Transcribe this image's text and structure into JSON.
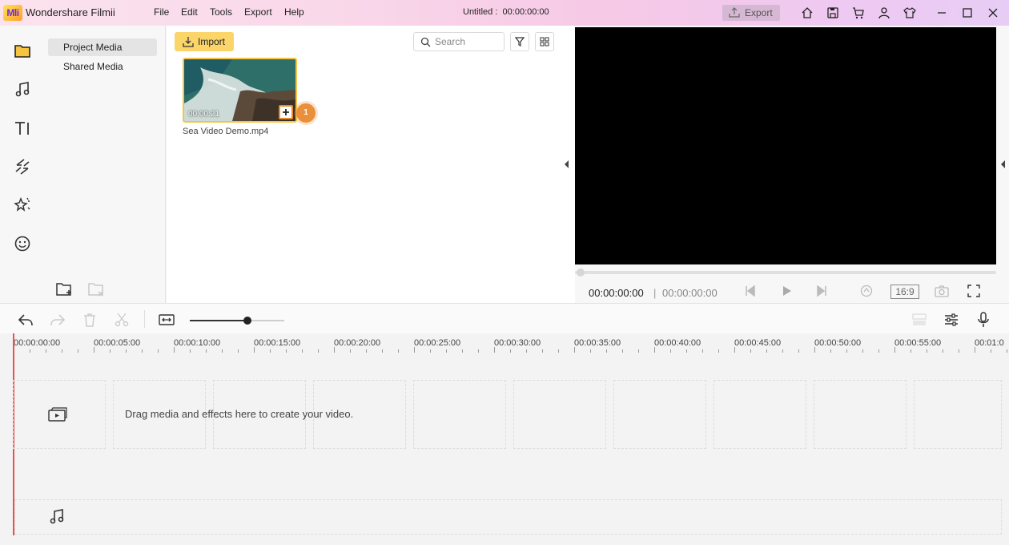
{
  "app": {
    "logo_text": "Mli",
    "name": "Wondershare Filmii"
  },
  "menu": [
    "File",
    "Edit",
    "Tools",
    "Export",
    "Help"
  ],
  "document": {
    "title": "Untitled :",
    "timecode": "00:00:00:00"
  },
  "titlebar": {
    "export_label": "Export",
    "icons": [
      "upload-icon",
      "home-icon",
      "save-icon",
      "cart-icon",
      "user-icon",
      "shirt-icon",
      "minimize-icon",
      "maximize-icon",
      "close-icon"
    ]
  },
  "rail": {
    "icons": [
      "folder-icon",
      "music-icon",
      "text-icon",
      "transition-icon",
      "effects-icon",
      "sticker-icon"
    ],
    "active": "folder-icon"
  },
  "media_nav": {
    "items": [
      {
        "label": "Project Media",
        "active": true
      },
      {
        "label": "Shared Media",
        "active": false
      }
    ],
    "footer_icons": [
      "new-folder-icon",
      "delete-folder-icon"
    ]
  },
  "media": {
    "import_label": "Import",
    "search_placeholder": "Search",
    "clip": {
      "name": "Sea Video Demo.mp4",
      "duration": "00:00:21",
      "badge": "1"
    }
  },
  "preview": {
    "current_time": "00:00:00:00",
    "separator": "|",
    "total_time": "00:00:00:00",
    "aspect_ratio": "16:9"
  },
  "toolbar": {
    "icons": [
      "undo-icon",
      "redo-icon",
      "trash-icon",
      "scissors-icon",
      "fit-icon"
    ],
    "right_icons": [
      "marker-icon",
      "adjust-icon",
      "microphone-icon"
    ],
    "zoom_level_fraction": 0.61
  },
  "timeline": {
    "ruler": [
      "00:00:00:00",
      "00:00:05:00",
      "00:00:10:00",
      "00:00:15:00",
      "00:00:20:00",
      "00:00:25:00",
      "00:00:30:00",
      "00:00:35:00",
      "00:00:40:00",
      "00:00:45:00",
      "00:00:50:00",
      "00:00:55:00",
      "00:01:0"
    ],
    "drop_hint": "Drag media and effects here to create your video."
  },
  "colors": {
    "accent": "#fbd56a",
    "badge": "#ea8f3a",
    "playhead": "#ef4f4f",
    "selection": "#f5c542"
  }
}
